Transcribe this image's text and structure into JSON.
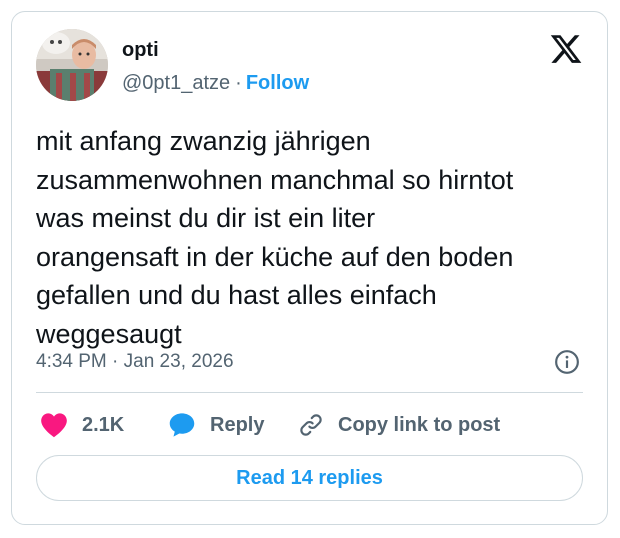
{
  "author": {
    "name": "opti",
    "handle": "@0pt1_atze",
    "separator": "·",
    "follow_label": "Follow",
    "avatar_icon": "profile-photo"
  },
  "brand": {
    "icon": "x-logo-icon"
  },
  "tweet": {
    "text": "mit anfang zwanzig jährigen\nzusammenwohnen manchmal so hirntot\nwas meinst du dir ist ein liter\norangensaft in der küche auf den boden\ngefallen und du hast alles einfach\nweggesaugt",
    "timestamp": "4:34 PM · Jan 23, 2026",
    "info_icon": "info-icon"
  },
  "actions": {
    "like": {
      "icon": "heart-icon",
      "count": "2.1K",
      "color": "#f91880"
    },
    "reply": {
      "icon": "speech-bubble-icon",
      "label": "Reply",
      "color": "#1d9bf0"
    },
    "copy_link": {
      "icon": "link-icon",
      "label": "Copy link to post"
    }
  },
  "footer": {
    "read_replies_label": "Read 14 replies"
  },
  "colors": {
    "accent": "#1d9bf0",
    "text_primary": "#0f1419",
    "text_secondary": "#536471",
    "border": "#cfd9de"
  }
}
